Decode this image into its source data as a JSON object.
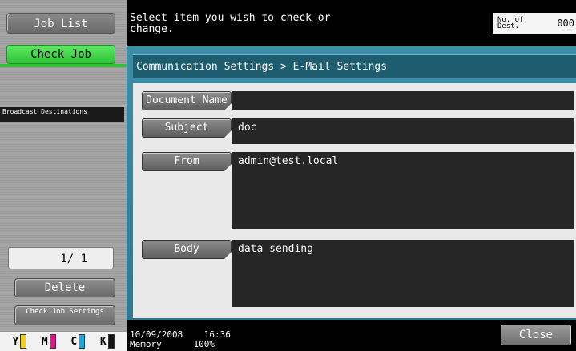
{
  "left": {
    "job_list": "Job List",
    "check_job": "Check Job",
    "broadcast_destinations": "Broadcast Destinations",
    "page_indicator": "1/ 1",
    "delete": "Delete",
    "check_job_settings": "Check Job Settings",
    "toner": [
      {
        "label": "Y",
        "color": "#f2d21b"
      },
      {
        "label": "M",
        "color": "#e0158c"
      },
      {
        "label": "C",
        "color": "#19a9e0"
      },
      {
        "label": "K",
        "color": "#111111"
      }
    ]
  },
  "header": {
    "message": "Select item you wish to check or change.",
    "dest_label": "No. of Dest.",
    "dest_value": "000"
  },
  "panel": {
    "breadcrumb": "Communication Settings > E-Mail Settings",
    "fields": [
      {
        "label": "Document Name",
        "value": ""
      },
      {
        "label": "Subject",
        "value": "doc"
      },
      {
        "label": "From",
        "value": "admin@test.local"
      },
      {
        "label": "Body",
        "value": "data sending"
      }
    ]
  },
  "footer": {
    "date": "10/09/2008",
    "time": "16:36",
    "memory_label": "Memory",
    "memory_value": "100%",
    "close": "Close"
  },
  "colors": {
    "accent_green": "#2fc236",
    "panel_blue": "#3d8ea7",
    "field_bg": "#262626"
  }
}
